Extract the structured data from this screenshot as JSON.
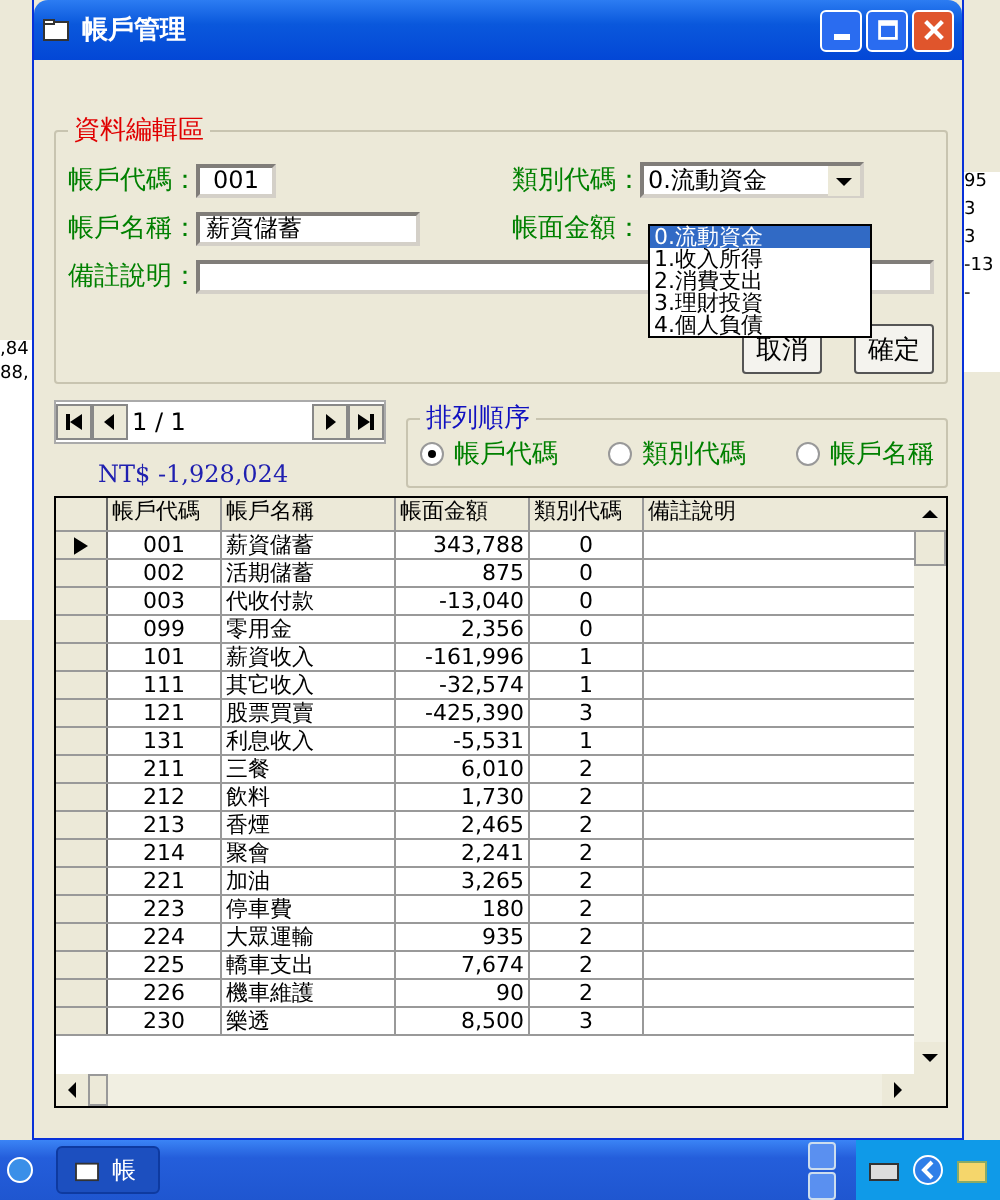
{
  "background": {
    "left_texts": [
      ",84",
      "88,"
    ],
    "right_texts": [
      "95",
      "3",
      "3",
      "-13",
      "-"
    ]
  },
  "window": {
    "title": "帳戶管理"
  },
  "edit_group": {
    "title": "資料編輯區",
    "account_code": {
      "label": "帳戶代碼：",
      "value": "001"
    },
    "account_name": {
      "label": "帳戶名稱：",
      "value": "薪資儲蓄"
    },
    "note": {
      "label": "備註說明："
    },
    "category": {
      "label": "類別代碼：",
      "value": "0.流動資金",
      "expanded": true,
      "options": [
        {
          "label": "0.流動資金",
          "selected": true
        },
        {
          "label": "1.收入所得",
          "selected": false
        },
        {
          "label": "2.消費支出",
          "selected": false
        },
        {
          "label": "3.理財投資",
          "selected": false
        },
        {
          "label": "4.個人負債",
          "selected": false
        }
      ]
    },
    "amount": {
      "label": "帳面金額："
    },
    "buttons": [
      "取消",
      "確定"
    ]
  },
  "navigator": {
    "position": "1 / 1"
  },
  "total": "NT$ -1,928,024",
  "sort": {
    "title": "排列順序",
    "options": [
      {
        "label": "帳戶代碼",
        "selected": true
      },
      {
        "label": "類別代碼",
        "selected": false
      },
      {
        "label": "帳戶名稱",
        "selected": false
      }
    ]
  },
  "table": {
    "columns": [
      "帳戶代碼",
      "帳戶名稱",
      "帳面金額",
      "類別代碼",
      "備註說明"
    ],
    "rows": [
      {
        "code": "001",
        "name": "薪資儲蓄",
        "amount": "343,788",
        "category": "0",
        "selected": true
      },
      {
        "code": "002",
        "name": "活期儲蓄",
        "amount": "875",
        "category": "0",
        "selected": false
      },
      {
        "code": "003",
        "name": "代收付款",
        "amount": "-13,040",
        "category": "0",
        "selected": false
      },
      {
        "code": "099",
        "name": "零用金",
        "amount": "2,356",
        "category": "0",
        "selected": false
      },
      {
        "code": "101",
        "name": "薪資收入",
        "amount": "-161,996",
        "category": "1",
        "selected": false
      },
      {
        "code": "111",
        "name": "其它收入",
        "amount": "-32,574",
        "category": "1",
        "selected": false
      },
      {
        "code": "121",
        "name": "股票買賣",
        "amount": "-425,390",
        "category": "3",
        "selected": false
      },
      {
        "code": "131",
        "name": "利息收入",
        "amount": "-5,531",
        "category": "1",
        "selected": false
      },
      {
        "code": "211",
        "name": "三餐",
        "amount": "6,010",
        "category": "2",
        "selected": false
      },
      {
        "code": "212",
        "name": "飲料",
        "amount": "1,730",
        "category": "2",
        "selected": false
      },
      {
        "code": "213",
        "name": "香煙",
        "amount": "2,465",
        "category": "2",
        "selected": false
      },
      {
        "code": "214",
        "name": "聚會",
        "amount": "2,241",
        "category": "2",
        "selected": false
      },
      {
        "code": "221",
        "name": "加油",
        "amount": "3,265",
        "category": "2",
        "selected": false
      },
      {
        "code": "223",
        "name": "停車費",
        "amount": "180",
        "category": "2",
        "selected": false
      },
      {
        "code": "224",
        "name": "大眾運輸",
        "amount": "935",
        "category": "2",
        "selected": false
      },
      {
        "code": "225",
        "name": "轎車支出",
        "amount": "7,674",
        "category": "2",
        "selected": false
      },
      {
        "code": "226",
        "name": "機車維護",
        "amount": "90",
        "category": "2",
        "selected": false
      },
      {
        "code": "230",
        "name": "樂透",
        "amount": "8,500",
        "category": "3",
        "selected": false
      }
    ]
  },
  "taskbar": {
    "button": "帳"
  }
}
